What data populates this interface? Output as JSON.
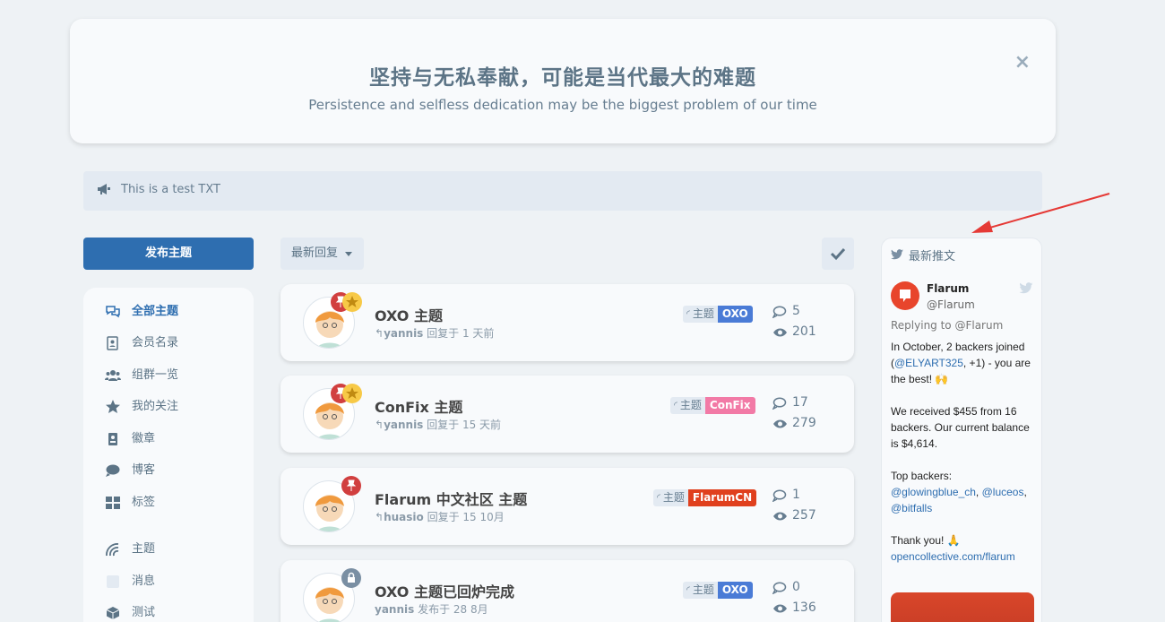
{
  "hero": {
    "title": "坚持与无私奉献，可能是当代最大的难题",
    "subtitle": "Persistence and selfless dedication may be the biggest problem of our time",
    "close": "×"
  },
  "notice": {
    "text": "This is a test TXT"
  },
  "start_button": "发布主题",
  "sort": {
    "label": "最新回复"
  },
  "sidebar": {
    "items": [
      {
        "label": "全部主题",
        "icon": "comments-icon",
        "active": true
      },
      {
        "label": "会员名录",
        "icon": "address-book-icon"
      },
      {
        "label": "组群一览",
        "icon": "users-icon"
      },
      {
        "label": "我的关注",
        "icon": "star-icon"
      },
      {
        "label": "徽章",
        "icon": "id-badge-icon"
      },
      {
        "label": "博客",
        "icon": "comment-icon"
      },
      {
        "label": "标签",
        "icon": "grid-icon"
      },
      {
        "label": "主题",
        "icon": "rainbow-icon"
      },
      {
        "label": "消息",
        "icon": "square-icon"
      },
      {
        "label": "测试",
        "icon": "cube-icon"
      }
    ]
  },
  "discussions": [
    {
      "title": "OXO 主题",
      "user": "yannis",
      "action": "回复于 1 天前",
      "tag1": "主题",
      "tag2": "OXO",
      "tag2_color": "#4a7bd6",
      "replies": "5",
      "views": "201",
      "badges": [
        "pin",
        "star"
      ]
    },
    {
      "title": "ConFix 主题",
      "user": "yannis",
      "action": "回复于 15 天前",
      "tag1": "主题",
      "tag2": "ConFix",
      "tag2_color": "#f27aa6",
      "replies": "17",
      "views": "279",
      "badges": [
        "pin",
        "star"
      ]
    },
    {
      "title": "Flarum 中文社区 主题",
      "user": "huasio",
      "action": "回复于 15 10月",
      "tag1": "主题",
      "tag2": "FlarumCN",
      "tag2_color": "#e0401e",
      "replies": "1",
      "views": "257",
      "badges": [
        "pin"
      ]
    },
    {
      "title": "OXO 主题已回炉完成",
      "user": "yannis",
      "action": "发布于 28 8月",
      "tag1": "主题",
      "tag2": "OXO",
      "tag2_color": "#4a7bd6",
      "replies": "0",
      "views": "136",
      "badges": [
        "lock"
      ]
    }
  ],
  "tweets": {
    "header": "最新推文",
    "name": "Flarum",
    "handle": "@Flarum",
    "reply": "Replying to @Flarum",
    "p1a": "In October, 2 backers joined (",
    "p1link": "@ELYART325",
    "p1b": ", +1) - you are the best! 🙌",
    "p2": "We received $455 from 16 backers. Our current balance is $4,614.",
    "p3a": "Top backers: ",
    "p3l1": "@glowingblue_ch",
    "p3sep": ", ",
    "p3l2": "@luceos",
    "p3sep2": ", ",
    "p3l3": "@bitfalls",
    "p4": "Thank you! 🙏",
    "p5": "opencollective.com/flarum"
  }
}
